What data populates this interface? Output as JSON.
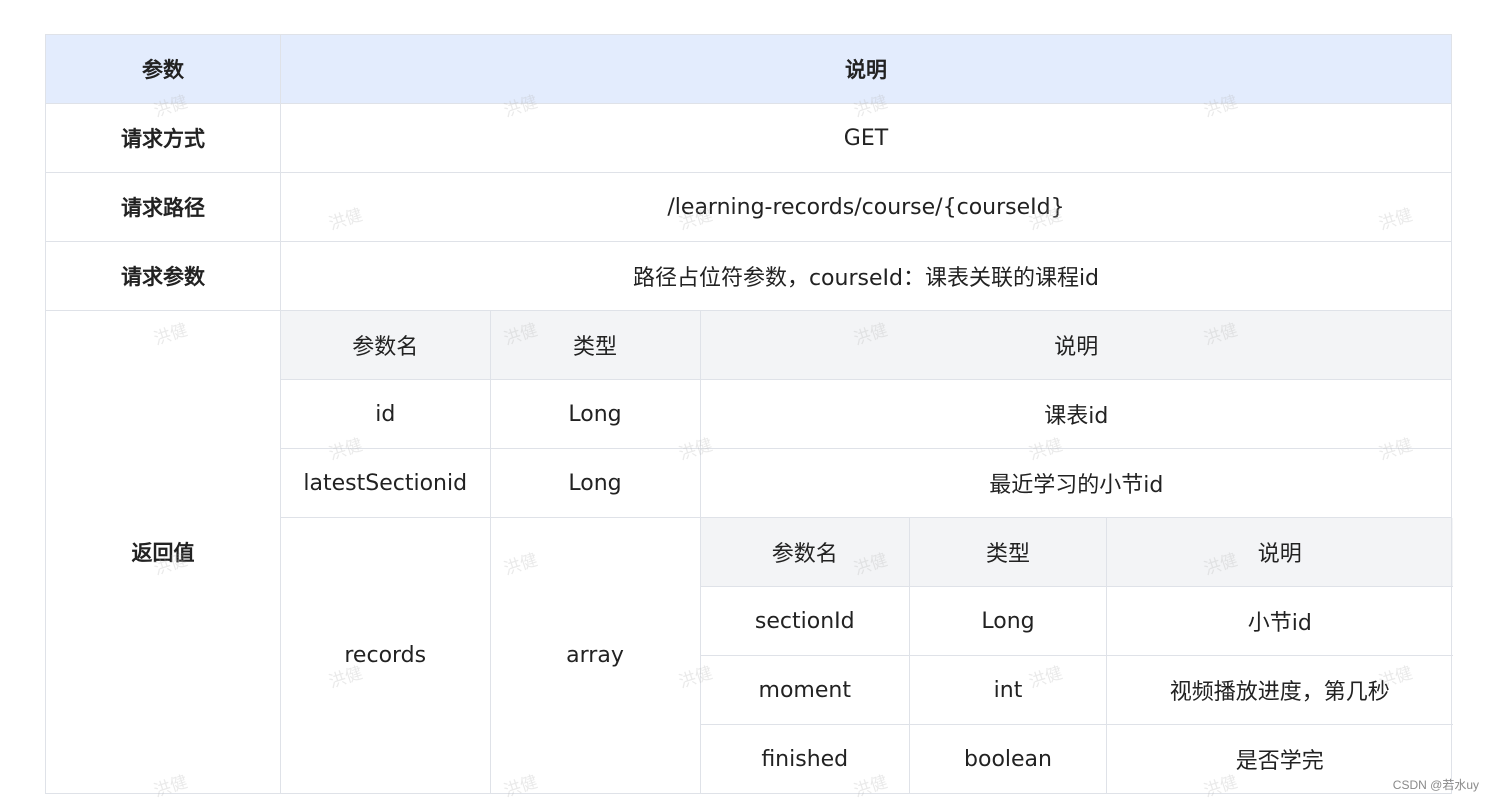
{
  "table": {
    "header": {
      "param": "参数",
      "desc": "说明"
    },
    "rows": {
      "method": {
        "label": "请求方式",
        "value": "GET"
      },
      "path": {
        "label": "请求路径",
        "value": "/learning-records/course/{courseId}"
      },
      "params": {
        "label": "请求参数",
        "value": "路径占位符参数，courseId：课表关联的课程id"
      },
      "returns": {
        "label": "返回值",
        "header": {
          "name": "参数名",
          "type": "类型",
          "desc": "说明"
        },
        "fields": [
          {
            "name": "id",
            "type": "Long",
            "desc": "课表id"
          },
          {
            "name": "latestSectionid",
            "type": "Long",
            "desc": "最近学习的小节id"
          }
        ],
        "records": {
          "name": "records",
          "type": "array",
          "header": {
            "name": "参数名",
            "type": "类型",
            "desc": "说明"
          },
          "fields": [
            {
              "name": "sectionId",
              "type": "Long",
              "desc": "小节id"
            },
            {
              "name": "moment",
              "type": "int",
              "desc": "视频播放进度，第几秒"
            },
            {
              "name": "finished",
              "type": "boolean",
              "desc": "是否学完"
            }
          ]
        }
      }
    }
  },
  "watermark": "洪健",
  "credit": "CSDN @若水uy"
}
